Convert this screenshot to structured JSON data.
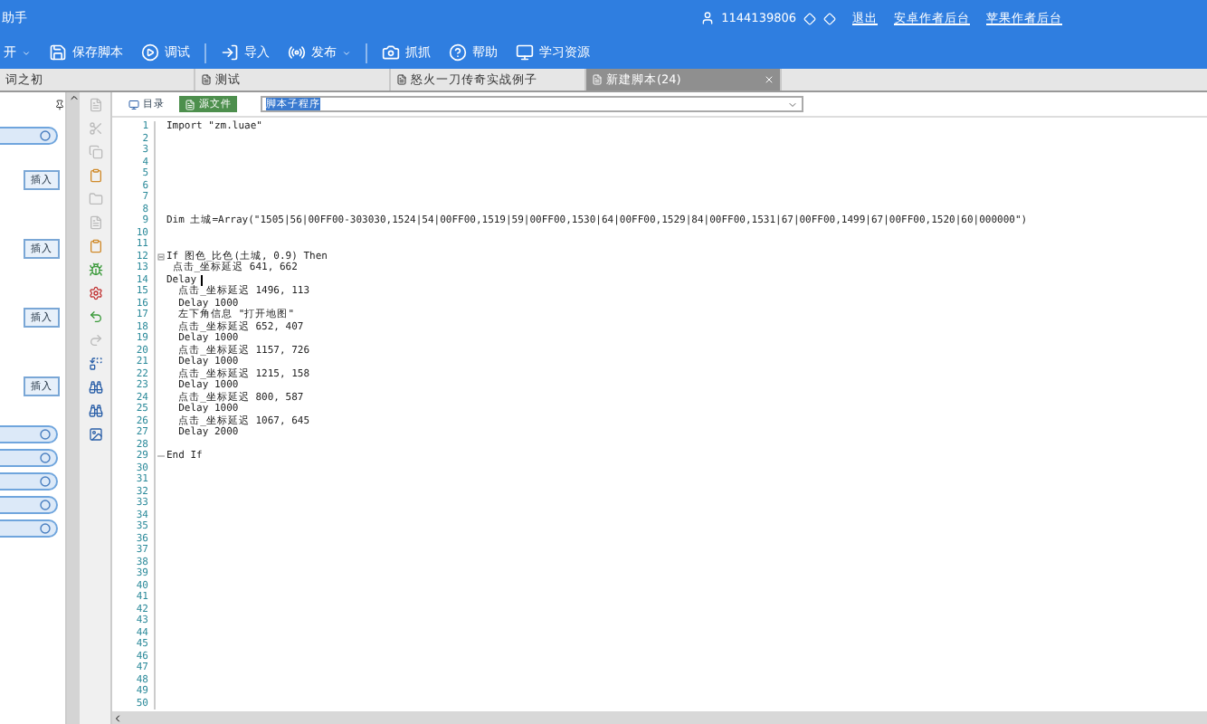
{
  "window": {
    "title": "助手"
  },
  "account": {
    "user": "1144139806",
    "links": [
      "退出",
      "安卓作者后台",
      "苹果作者后台"
    ]
  },
  "toolbar": [
    {
      "kind": "dropdown",
      "label": "开"
    },
    {
      "kind": "button",
      "label": "保存脚本"
    },
    {
      "kind": "button",
      "label": "调试"
    },
    {
      "kind": "separator"
    },
    {
      "kind": "button",
      "label": "导入"
    },
    {
      "kind": "dropdown",
      "label": "发布"
    },
    {
      "kind": "separator"
    },
    {
      "kind": "button",
      "label": "抓抓"
    },
    {
      "kind": "button",
      "label": "帮助"
    },
    {
      "kind": "button",
      "label": "学习资源"
    }
  ],
  "tabs": [
    {
      "label": "词之初",
      "selected": false
    },
    {
      "label": "测试",
      "selected": false
    },
    {
      "label": "怒火一刀传奇实战例子",
      "selected": false
    },
    {
      "label": "新建脚本(24)",
      "selected": true
    }
  ],
  "editor_toolbar": {
    "catalog": "目录",
    "source": "源文件",
    "selector": "脚本子程序"
  },
  "left_panel": [
    {
      "kind": "pill"
    },
    {
      "kind": "insert",
      "label": "插入"
    },
    {
      "kind": "insert",
      "label": "插入"
    },
    {
      "kind": "insert",
      "label": "插入"
    },
    {
      "kind": "insert",
      "label": "插入"
    },
    {
      "kind": "pill"
    },
    {
      "kind": "pill"
    },
    {
      "kind": "pill"
    },
    {
      "kind": "pill"
    },
    {
      "kind": "pill"
    }
  ],
  "code": [
    {
      "number": "1",
      "text": "Import \"zm.luae\""
    },
    {
      "number": "2"
    },
    {
      "number": "3"
    },
    {
      "number": "4"
    },
    {
      "number": "5"
    },
    {
      "number": "6"
    },
    {
      "number": "7"
    },
    {
      "number": "8"
    },
    {
      "number": "9",
      "text": "Dim 土城=Array(\"1505|56|00FF00-303030,1524|54|00FF00,1519|59|00FF00,1530|64|00FF00,1529|84|00FF00,1531|67|00FF00,1499|67|00FF00,1520|60|000000\")"
    },
    {
      "number": "10"
    },
    {
      "number": "11"
    },
    {
      "number": "12",
      "text": "If 图色_比色(土城, 0.9) Then",
      "fold_start": true
    },
    {
      "number": "13",
      "text": " 点击_坐标延迟 641, 662"
    },
    {
      "number": "14",
      "text": "Delay",
      "caret": true
    },
    {
      "number": "15",
      "text": "  点击_坐标延迟 1496, 113"
    },
    {
      "number": "16",
      "text": "  Delay 1000"
    },
    {
      "number": "17",
      "text": "  左下角信息 \"打开地图\""
    },
    {
      "number": "18",
      "text": "  点击_坐标延迟 652, 407"
    },
    {
      "number": "19",
      "text": "  Delay 1000"
    },
    {
      "number": "20",
      "text": "  点击_坐标延迟 1157, 726"
    },
    {
      "number": "21",
      "text": "  Delay 1000"
    },
    {
      "number": "22",
      "text": "  点击_坐标延迟 1215, 158"
    },
    {
      "number": "23",
      "text": "  Delay 1000"
    },
    {
      "number": "24",
      "text": "  点击_坐标延迟 800, 587"
    },
    {
      "number": "25",
      "text": "  Delay 1000"
    },
    {
      "number": "26",
      "text": "  点击_坐标延迟 1067, 645"
    },
    {
      "number": "27",
      "text": "  Delay 2000"
    },
    {
      "number": "28"
    },
    {
      "number": "29",
      "text": "End If",
      "fold_end": true
    },
    {
      "number": "30"
    },
    {
      "number": "31"
    },
    {
      "number": "32"
    },
    {
      "number": "33"
    },
    {
      "number": "34"
    },
    {
      "number": "35"
    },
    {
      "number": "36"
    },
    {
      "number": "37"
    },
    {
      "number": "38"
    },
    {
      "number": "39"
    },
    {
      "number": "40"
    },
    {
      "number": "41"
    },
    {
      "number": "42"
    },
    {
      "number": "43"
    },
    {
      "number": "44"
    },
    {
      "number": "45"
    },
    {
      "number": "46"
    },
    {
      "number": "47"
    },
    {
      "number": "48"
    },
    {
      "number": "49"
    },
    {
      "number": "50"
    }
  ]
}
